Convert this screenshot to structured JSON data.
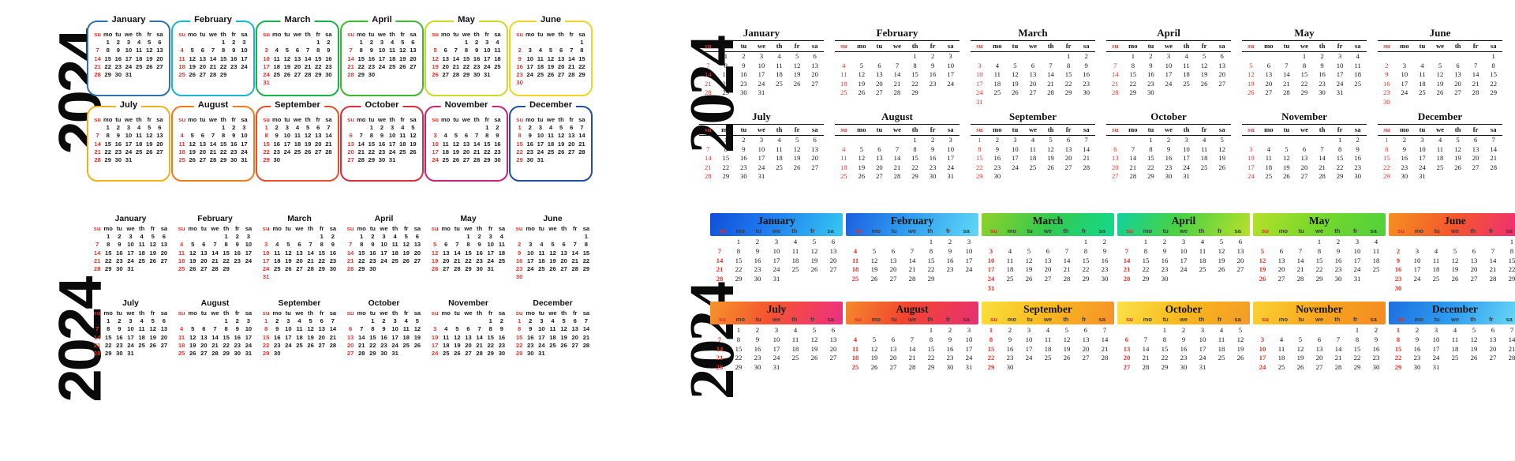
{
  "year": "2024",
  "weekday_headers": [
    "su",
    "mo",
    "tu",
    "we",
    "th",
    "fr",
    "sa"
  ],
  "sunday_color": "#e8342c",
  "months": [
    {
      "name": "January",
      "start": 1,
      "days": 31
    },
    {
      "name": "February",
      "start": 4,
      "days": 29
    },
    {
      "name": "March",
      "start": 5,
      "days": 31
    },
    {
      "name": "April",
      "start": 1,
      "days": 30
    },
    {
      "name": "May",
      "start": 3,
      "days": 31
    },
    {
      "name": "June",
      "start": 6,
      "days": 30
    },
    {
      "name": "July",
      "start": 1,
      "days": 31
    },
    {
      "name": "August",
      "start": 4,
      "days": 31
    },
    {
      "name": "September",
      "start": 0,
      "days": 30
    },
    {
      "name": "October",
      "start": 2,
      "days": 31
    },
    {
      "name": "November",
      "start": 5,
      "days": 30
    },
    {
      "name": "December",
      "start": 0,
      "days": 31
    }
  ],
  "variants": [
    {
      "id": "rounded-frame-calendar",
      "style": "rounded-colored-frames",
      "month_colors": [
        "#2f6fb0",
        "#18b6cf",
        "#18b24a",
        "#3eb82e",
        "#cdd827",
        "#f6d129",
        "#f2b01e",
        "#ee7c1b",
        "#ea4f2a",
        "#e02b3d",
        "#cc1f7a",
        "#1f4fa0"
      ]
    },
    {
      "id": "serif-rule-calendar",
      "style": "serif-with-rules",
      "rule_color": "#111111"
    },
    {
      "id": "plain-calendar",
      "style": "plain-no-border"
    },
    {
      "id": "gradient-header-calendar",
      "style": "gradient-header-blocks",
      "month_gradients": [
        "linear-gradient(115deg,#0f4fd8 0%,#1f77ee 40%,#34c9f2 100%)",
        "linear-gradient(115deg,#1b5fe0 0%,#2f9bf0 45%,#5fd8f5 100%)",
        "linear-gradient(115deg,#8fd12a 0%,#34c94f 50%,#12d98c 100%)",
        "linear-gradient(115deg,#12d19a 0%,#48d146 45%,#b9e02a 100%)",
        "linear-gradient(115deg,#b6e02a 0%,#7ad82c 45%,#4fd03d 100%)",
        "linear-gradient(115deg,#f59020 0%,#f4562e 50%,#ef2b7a 100%)",
        "linear-gradient(115deg,#f7952a 0%,#f4542f 45%,#ee2e86 100%)",
        "linear-gradient(115deg,#f58a2c 0%,#f2452f 45%,#e82f74 100%)",
        "linear-gradient(115deg,#f9e03c 0%,#f9b81e 50%,#f6902a 100%)",
        "linear-gradient(115deg,#fbe24a 0%,#f8b81c 50%,#f49a28 100%)",
        "linear-gradient(115deg,#fbd234 0%,#f7a61e 50%,#f48a24 100%)",
        "linear-gradient(115deg,#1e6fe0 0%,#2f9ef0 50%,#6fdcf6 100%)"
      ]
    }
  ]
}
